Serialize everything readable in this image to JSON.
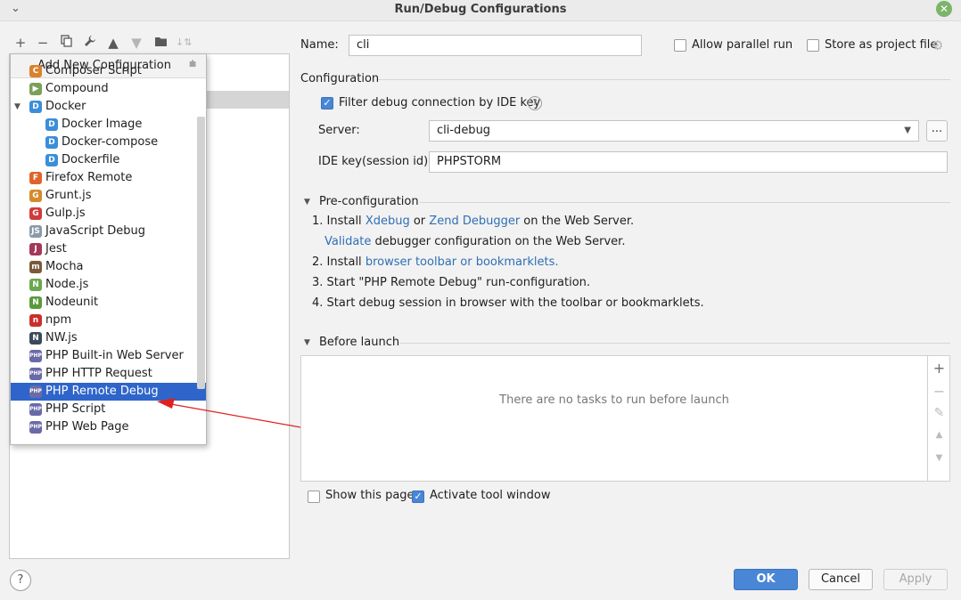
{
  "window": {
    "title": "Run/Debug Configurations",
    "menu_chevron": "⌄",
    "close_glyph": "✕"
  },
  "toolbar": {
    "icons": [
      "add-icon",
      "remove-icon",
      "copy-icon",
      "wrench-icon",
      "move-up-icon",
      "move-down-icon",
      "folder-icon",
      "sort-icon"
    ]
  },
  "popup": {
    "title": "Add New Configuration",
    "items": [
      {
        "label": "Composer Script",
        "icon": "composer-icon",
        "color": "#d9822b",
        "glyph": "C"
      },
      {
        "label": "Compound",
        "icon": "compound-icon",
        "color": "#7aa05a",
        "glyph": "▶"
      },
      {
        "label": "Docker",
        "icon": "docker-icon",
        "color": "#3b8ed8",
        "glyph": "D"
      },
      {
        "label": "Docker Image",
        "icon": "docker-icon",
        "color": "#3b8ed8",
        "glyph": "D"
      },
      {
        "label": "Docker-compose",
        "icon": "docker-icon",
        "color": "#3b8ed8",
        "glyph": "D"
      },
      {
        "label": "Dockerfile",
        "icon": "docker-icon",
        "color": "#3b8ed8",
        "glyph": "D"
      },
      {
        "label": "Firefox Remote",
        "icon": "firefox-icon",
        "color": "#e1632c",
        "glyph": "F"
      },
      {
        "label": "Grunt.js",
        "icon": "grunt-icon",
        "color": "#d68a2c",
        "glyph": "G"
      },
      {
        "label": "Gulp.js",
        "icon": "gulp-icon",
        "color": "#d13b3b",
        "glyph": "G"
      },
      {
        "label": "JavaScript Debug",
        "icon": "js-debug-icon",
        "color": "#8a9aa8",
        "glyph": "JS"
      },
      {
        "label": "Jest",
        "icon": "jest-icon",
        "color": "#a3385a",
        "glyph": "J"
      },
      {
        "label": "Mocha",
        "icon": "mocha-icon",
        "color": "#7a5a3a",
        "glyph": "m"
      },
      {
        "label": "Node.js",
        "icon": "nodejs-icon",
        "color": "#6aa84f",
        "glyph": "N"
      },
      {
        "label": "Nodeunit",
        "icon": "nodeunit-icon",
        "color": "#5a9a3a",
        "glyph": "N"
      },
      {
        "label": "npm",
        "icon": "npm-icon",
        "color": "#c9302c",
        "glyph": "n"
      },
      {
        "label": "NW.js",
        "icon": "nwjs-icon",
        "color": "#3a4a5a",
        "glyph": "N"
      },
      {
        "label": "PHP Built-in Web Server",
        "icon": "php-icon",
        "color": "#6a6aa8",
        "glyph": "PHP"
      },
      {
        "label": "PHP HTTP Request",
        "icon": "php-icon",
        "color": "#6a6aa8",
        "glyph": "PHP"
      },
      {
        "label": "PHP Remote Debug",
        "icon": "php-icon",
        "color": "#6a6aa8",
        "glyph": "PHP"
      },
      {
        "label": "PHP Script",
        "icon": "php-icon",
        "color": "#6a6aa8",
        "glyph": "PHP"
      },
      {
        "label": "PHP Web Page",
        "icon": "php-icon",
        "color": "#6a6aa8",
        "glyph": "PHP"
      }
    ]
  },
  "form": {
    "name_label": "Name:",
    "name_value": "cli",
    "allow_parallel": "Allow parallel run",
    "store_as_project": "Store as project file",
    "configuration_header": "Configuration",
    "filter_debug": "Filter debug connection by IDE key",
    "server_label": "Server:",
    "server_value": "cli-debug",
    "dots": "...",
    "ide_key_label": "IDE key(session id):",
    "ide_key_value": "PHPSTORM"
  },
  "preconfig": {
    "header": "Pre-configuration",
    "step1_prefix": "1. Install ",
    "step1_link1": "Xdebug",
    "step1_or": " or ",
    "step1_link2": "Zend Debugger",
    "step1_suffix": " on the Web Server.",
    "step1b_link": "Validate",
    "step1b_suffix": " debugger configuration on the Web Server.",
    "step2_prefix": "2. Install ",
    "step2_link": "browser toolbar or bookmarklets.",
    "step3": "3. Start \"PHP Remote Debug\" run-configuration.",
    "step4": "4. Start debug session in browser with the toolbar or bookmarklets."
  },
  "before_launch": {
    "header": "Before launch",
    "empty": "There are no tasks to run before launch",
    "show_page": "Show this page",
    "activate_tool": "Activate tool window"
  },
  "buttons": {
    "ok": "OK",
    "cancel": "Cancel",
    "apply": "Apply",
    "help": "?"
  },
  "colors": {
    "accent": "#4a86d6",
    "selection": "#2f65ca",
    "link": "#2f6fb5",
    "arrow": "#e02020"
  }
}
